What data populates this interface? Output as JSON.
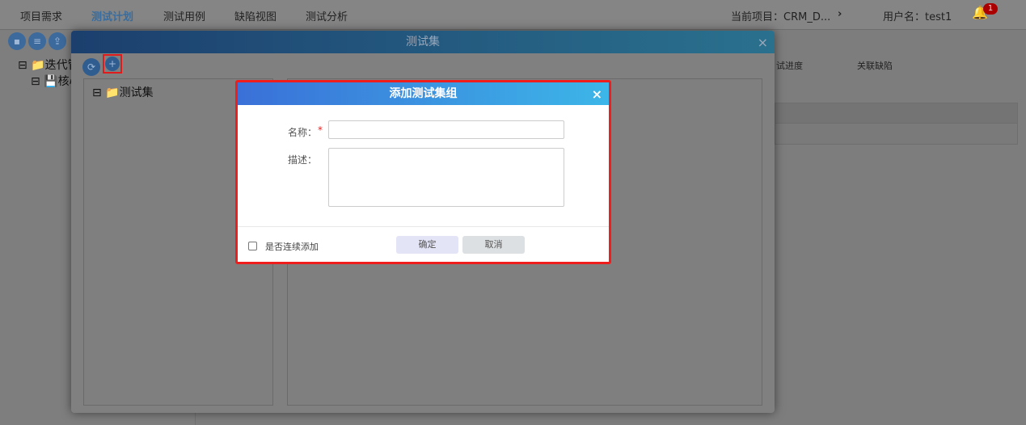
{
  "nav": {
    "items": [
      "项目需求",
      "测试计划",
      "测试用例",
      "缺陷视图",
      "测试分析"
    ],
    "project": "当前项目：CRM_D...",
    "user": "用户名：test1",
    "notifications": "1"
  },
  "left": {
    "tree": [
      "迭代管",
      "核心"
    ]
  },
  "right": {
    "tabs": [
      "试进度",
      "关联缺陷"
    ]
  },
  "dialog": {
    "title": "测试集",
    "close": "×",
    "tree_root": "测试集"
  },
  "modal": {
    "title": "添加测试集组",
    "close": "×",
    "name_label": "名称：",
    "required": "*",
    "desc_label": "描述：",
    "name_value": "",
    "desc_value": "",
    "continuous_label": "是否连续添加",
    "ok": "确定",
    "cancel": "取消"
  }
}
